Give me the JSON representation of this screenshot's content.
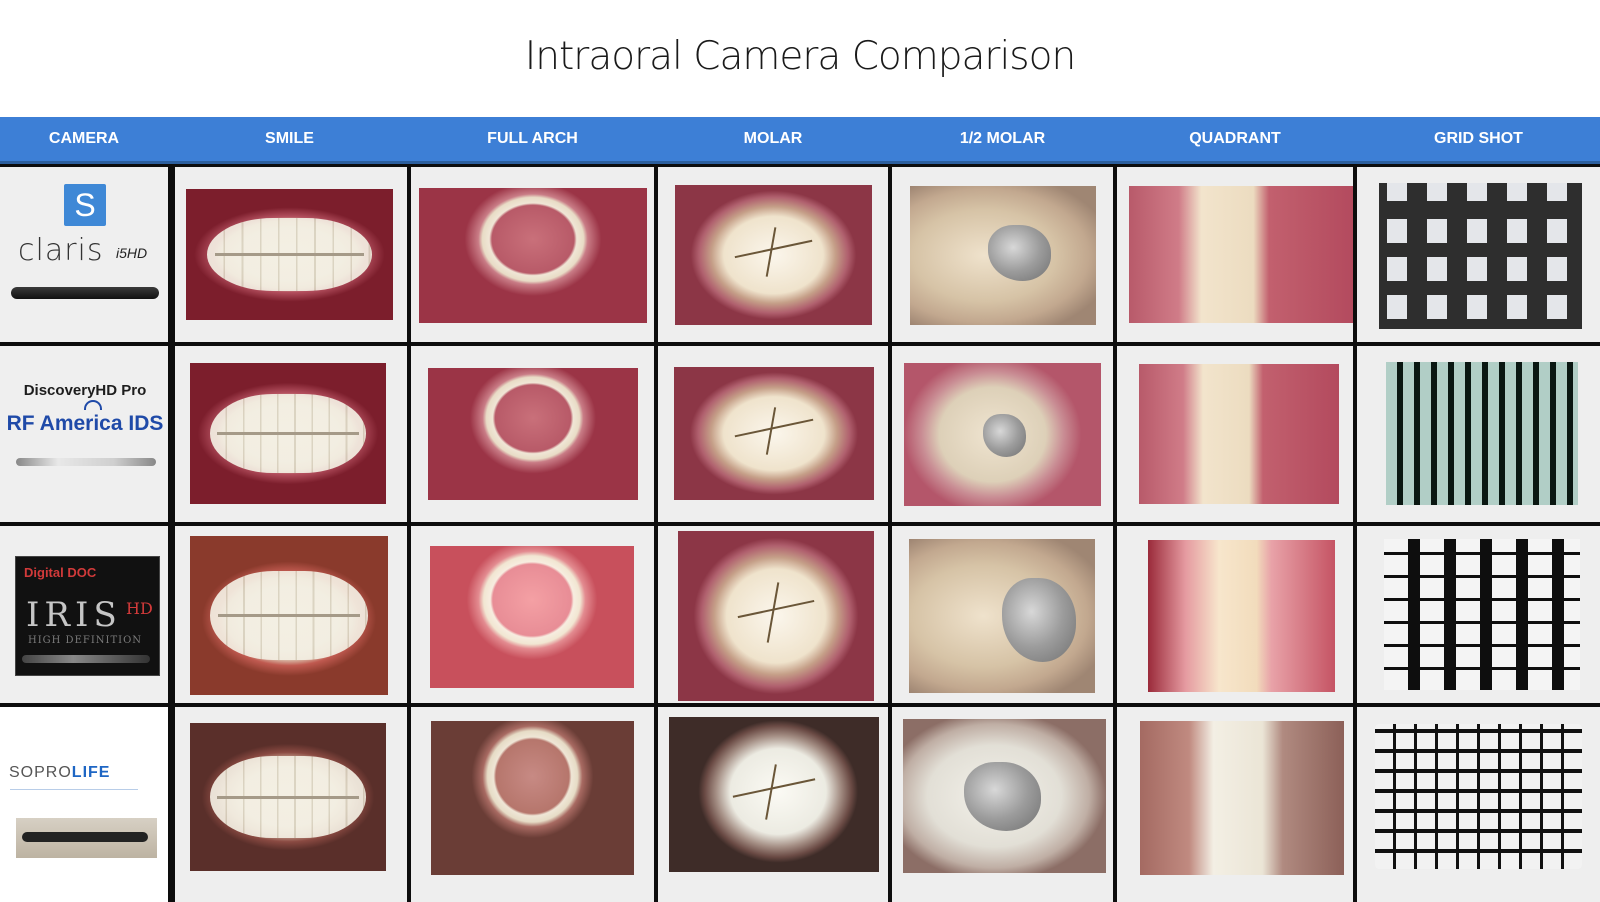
{
  "title": "Intraoral Camera Comparison",
  "columns": [
    "CAMERA",
    "SMILE",
    "FULL ARCH",
    "MOLAR",
    "1/2 MOLAR",
    "QUADRANT",
    "GRID SHOT"
  ],
  "cameras": {
    "claris": {
      "logo_letter": "S",
      "name": "claris",
      "model": "i5HD"
    },
    "discovery": {
      "line1": "DiscoveryHD Pro",
      "line2": "RF America IDS"
    },
    "iris": {
      "brand": "Digital DOC",
      "name": "IRIS",
      "hd": "HD",
      "sub": "HIGH DEFINITION"
    },
    "soprolife": {
      "part1": "SOPRO",
      "part2": "LIFE"
    }
  },
  "colors": {
    "header_bg": "#3d7fd6",
    "grid_border": "#0d0d0d",
    "claris_blue": "#3f88d6",
    "rf_blue": "#1f4aa8",
    "iris_red": "#d23a3a"
  }
}
